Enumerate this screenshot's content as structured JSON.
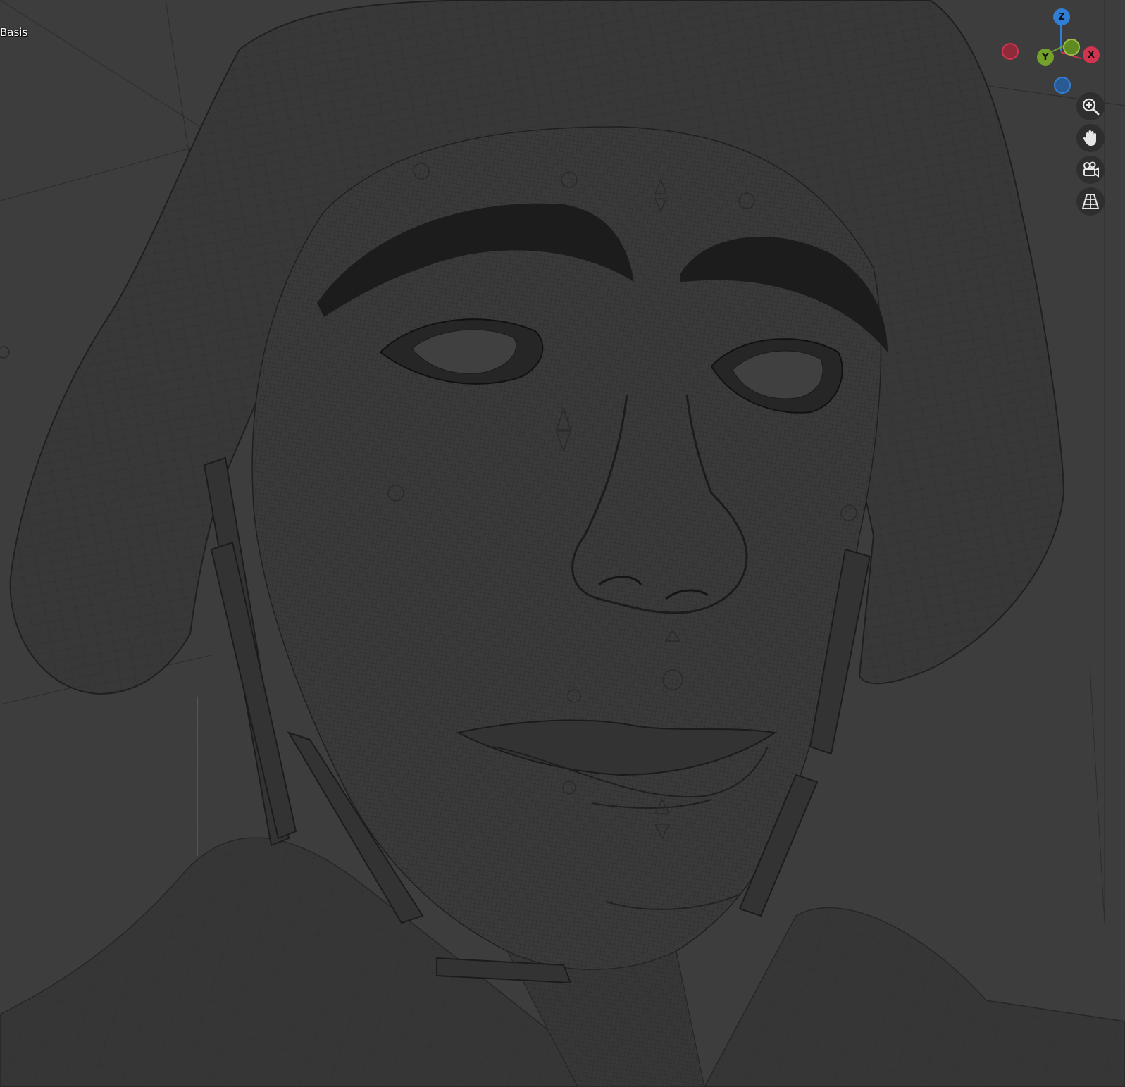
{
  "viewport": {
    "shape_key_label": "Basis",
    "background_color": "#3d3d3d",
    "wire_color": "#232323"
  },
  "gizmo": {
    "z_label": "Z",
    "y_label": "Y",
    "x_label": "X",
    "x_color": "#d1344f",
    "y_color": "#73a12a",
    "z_color": "#2f7fd6"
  },
  "nav_buttons": [
    {
      "icon": "zoom-in-icon"
    },
    {
      "icon": "hand-pan-icon"
    },
    {
      "icon": "camera-view-icon"
    },
    {
      "icon": "perspective-grid-icon"
    }
  ]
}
